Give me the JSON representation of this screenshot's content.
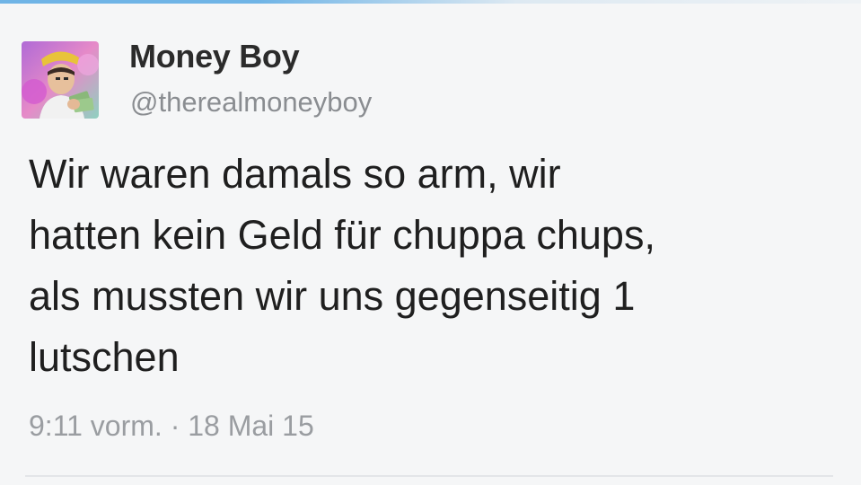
{
  "tweet": {
    "display_name": "Money Boy",
    "handle": "@therealmoneyboy",
    "text_lines": [
      "Wir waren damals so arm, wir",
      "hatten kein Geld für chuppa chups,",
      "als mussten wir uns gegenseitig 1",
      "lutschen"
    ],
    "time": "9:11 vorm.",
    "separator": " · ",
    "date": "18 Mai 15"
  },
  "colors": {
    "accent": "#6fb4e6",
    "background": "#f5f6f7",
    "name": "#2b2b2b",
    "secondary_text": "#8a8d91"
  }
}
